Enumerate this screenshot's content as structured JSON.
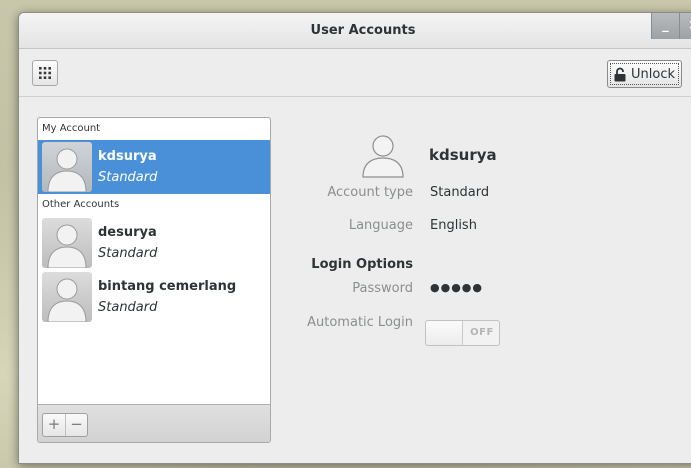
{
  "window": {
    "title": "User Accounts",
    "minimize_glyph": "_",
    "close_glyph": "×"
  },
  "toolbar": {
    "apps_icon": "grid-icon",
    "unlock_label": "Unlock",
    "unlock_icon": "padlock-icon"
  },
  "accounts": {
    "my_account_label": "My Account",
    "other_accounts_label": "Other Accounts",
    "my": {
      "name": "kdsurya",
      "type": "Standard"
    },
    "others": [
      {
        "name": "desurya",
        "type": "Standard"
      },
      {
        "name": "bintang cemerlang",
        "type": "Standard"
      }
    ],
    "add_label": "+",
    "remove_label": "−"
  },
  "details": {
    "name": "kdsurya",
    "account_type_label": "Account type",
    "account_type_value": "Standard",
    "language_label": "Language",
    "language_value": "English",
    "login_options_label": "Login Options",
    "password_label": "Password",
    "password_value": "●●●●●",
    "auto_login_label": "Automatic Login",
    "auto_login_state": "OFF"
  },
  "colors": {
    "selection": "#4a90d9",
    "window_bg": "#ededed",
    "muted_text": "#8b8e8f"
  }
}
